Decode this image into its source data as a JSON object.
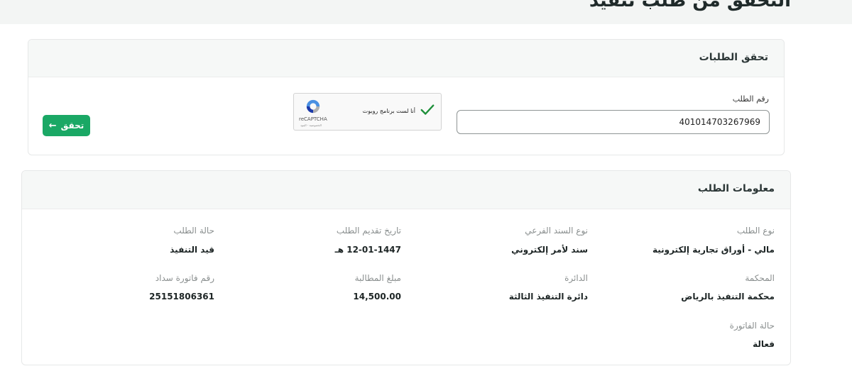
{
  "page": {
    "title": "التحقق من طلب تنفيذ"
  },
  "verify": {
    "title": "تحقق الطلبات",
    "request_number_label": "رقم الطلب",
    "request_number_value": "401014703267969",
    "captcha": {
      "text": "أنا لست برنامج روبوت",
      "brand": "reCAPTCHA",
      "links": "الخصوصية - البنود",
      "checked": true
    },
    "button_label": "تحقق",
    "button_icon": "arrow-left-icon"
  },
  "info": {
    "title": "معلومات الطلب",
    "fields": {
      "request_type": {
        "label": "نوع الطلب",
        "value": "مالي - أوراق تجارية إلكترونية"
      },
      "sub_document_type": {
        "label": "نوع السند الفرعي",
        "value": "سند لأمر إلكتروني"
      },
      "submission_date": {
        "label": "تاريخ تقديم الطلب",
        "value": "12-01-1447 هـ"
      },
      "request_status": {
        "label": "حالة الطلب",
        "value": "قيد التنفيذ"
      },
      "court": {
        "label": "المحكمة",
        "value": "محكمة التنفيذ بالرياض"
      },
      "circuit": {
        "label": "الدائرة",
        "value": "دائرة التنفيذ الثالثة"
      },
      "claim_amount": {
        "label": "مبلغ المطالبة",
        "value": "14,500.00"
      },
      "sadad_invoice": {
        "label": "رقم فاتورة سداد",
        "value": "25151806361"
      },
      "invoice_status": {
        "label": "حالة الفاتورة",
        "value": "فعالة"
      }
    }
  },
  "colors": {
    "accent_green": "#1aa865",
    "check_green": "#1e8f3a",
    "header_bg": "#f3f5f4"
  }
}
